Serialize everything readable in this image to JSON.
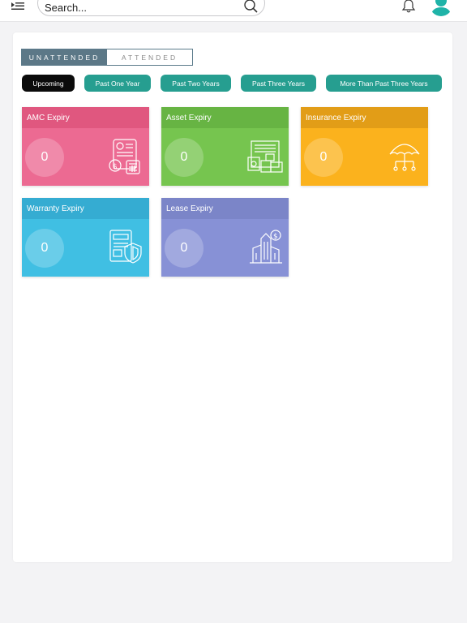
{
  "header": {
    "search_placeholder": "Search..."
  },
  "tabs": {
    "unattended": "UNATTENDED",
    "attended": "ATTENDED"
  },
  "filters": [
    "Upcoming",
    "Past One Year",
    "Past Two Years",
    "Past Three Years",
    "More Than Past Three Years"
  ],
  "cards": {
    "amc": {
      "title": "AMC Expiry",
      "count": "0"
    },
    "asset": {
      "title": "Asset Expiry",
      "count": "0"
    },
    "insurance": {
      "title": "Insurance Expiry",
      "count": "0"
    },
    "warranty": {
      "title": "Warranty Expiry",
      "count": "0"
    },
    "lease": {
      "title": "Lease Expiry",
      "count": "0"
    }
  },
  "icons": {
    "menu": "menu-collapse-icon",
    "search": "search-icon",
    "bell": "bell-icon",
    "avatar": "user-avatar-icon"
  },
  "colors": {
    "accent": "#269e90",
    "toggle_active": "#5c7887",
    "amc": "#ec6a92",
    "asset": "#76c54f",
    "insurance": "#fbb21d",
    "warranty": "#40bfe3",
    "lease": "#8791d6"
  }
}
